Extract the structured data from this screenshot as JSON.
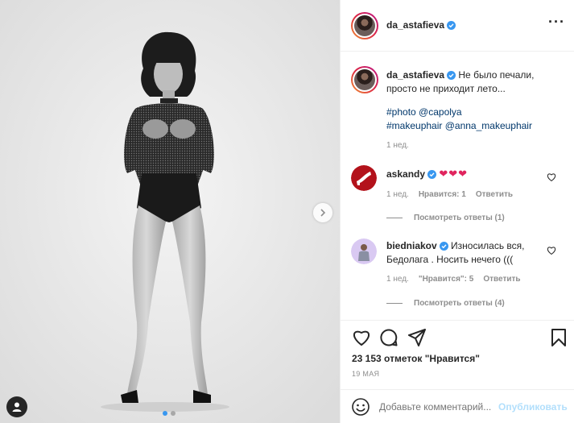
{
  "header": {
    "username": "da_astafieva",
    "more_icon": "more-horizontal-icon"
  },
  "caption": {
    "username": "da_astafieva",
    "text": "Не было печали, просто не приходит лето...",
    "tag1": "#photo",
    "mention1": "@capolya",
    "tag2": "#makeuphair",
    "mention2": "@anna_makeuphair",
    "time": "1 нед."
  },
  "comments": [
    {
      "username": "askandy",
      "text": "❤❤❤",
      "time": "1 нед.",
      "likes": "Нравится: 1",
      "reply": "Ответить",
      "view_replies": "Посмотреть ответы (1)"
    },
    {
      "username": "biedniakov",
      "text": "Износилась вся, Бедолага . Носить нечего (((",
      "time": "1 нед.",
      "likes": "\"Нравится\": 5",
      "reply": "Ответить",
      "view_replies": "Посмотреть ответы (4)"
    }
  ],
  "likes_text": "23 153 отметок \"Нравится\"",
  "date": "19 МАЯ",
  "add_comment": {
    "placeholder": "Добавьте комментарий...",
    "publish": "Опубликовать"
  },
  "carousel": {
    "slides": 2,
    "active": 1
  },
  "colors": {
    "link": "#00376b",
    "verified": "#3897f0",
    "publish_disabled": "#b2dffc",
    "heart_red": "#e0245e"
  }
}
